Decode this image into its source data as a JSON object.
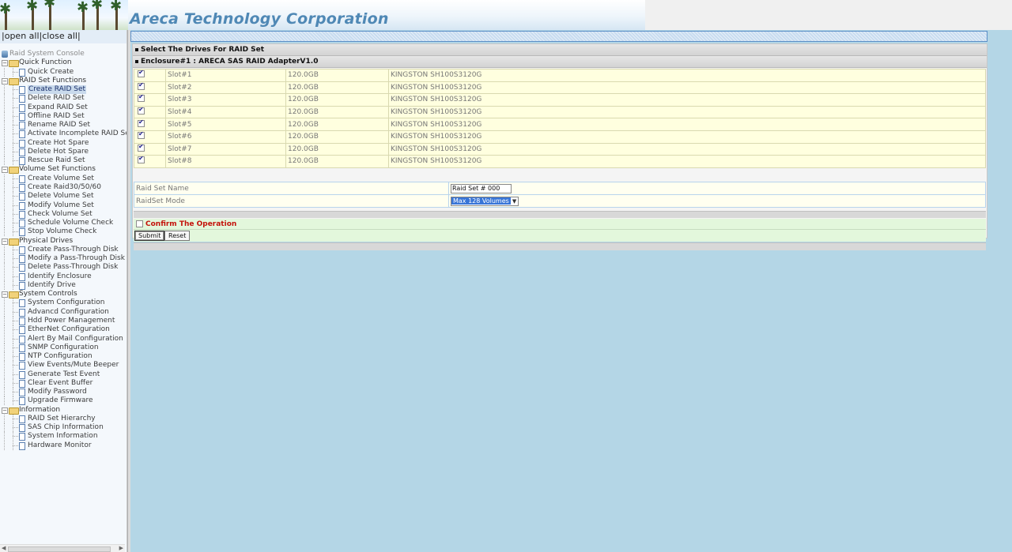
{
  "header": {
    "company": "Areca Technology Corporation"
  },
  "left": {
    "open_all": "open all",
    "close_all": "close all",
    "tree": [
      {
        "type": "root",
        "label": "Raid System Console"
      },
      {
        "type": "cat",
        "label": "Quick Function"
      },
      {
        "type": "leaf",
        "label": "Quick Create"
      },
      {
        "type": "cat",
        "label": "RAID Set Functions"
      },
      {
        "type": "leaf",
        "label": "Create RAID Set",
        "selected": true
      },
      {
        "type": "leaf",
        "label": "Delete RAID Set"
      },
      {
        "type": "leaf",
        "label": "Expand RAID Set"
      },
      {
        "type": "leaf",
        "label": "Offline RAID Set"
      },
      {
        "type": "leaf",
        "label": "Rename RAID Set"
      },
      {
        "type": "leaf",
        "label": "Activate Incomplete RAID Se"
      },
      {
        "type": "leaf",
        "label": "Create Hot Spare"
      },
      {
        "type": "leaf",
        "label": "Delete Hot Spare"
      },
      {
        "type": "leaf",
        "label": "Rescue Raid Set"
      },
      {
        "type": "cat",
        "label": "Volume Set Functions"
      },
      {
        "type": "leaf",
        "label": "Create Volume Set"
      },
      {
        "type": "leaf",
        "label": "Create Raid30/50/60"
      },
      {
        "type": "leaf",
        "label": "Delete Volume Set"
      },
      {
        "type": "leaf",
        "label": "Modify Volume Set"
      },
      {
        "type": "leaf",
        "label": "Check Volume Set"
      },
      {
        "type": "leaf",
        "label": "Schedule Volume Check"
      },
      {
        "type": "leaf",
        "label": "Stop Volume Check"
      },
      {
        "type": "cat",
        "label": "Physical Drives"
      },
      {
        "type": "leaf",
        "label": "Create Pass-Through Disk"
      },
      {
        "type": "leaf",
        "label": "Modify a Pass-Through Disk"
      },
      {
        "type": "leaf",
        "label": "Delete Pass-Through Disk"
      },
      {
        "type": "leaf",
        "label": "Identify Enclosure"
      },
      {
        "type": "leaf",
        "label": "Identify Drive"
      },
      {
        "type": "cat",
        "label": "System Controls"
      },
      {
        "type": "leaf",
        "label": "System Configuration"
      },
      {
        "type": "leaf",
        "label": "Advancd Configuration"
      },
      {
        "type": "leaf",
        "label": "Hdd Power Management"
      },
      {
        "type": "leaf",
        "label": "EtherNet Configuration"
      },
      {
        "type": "leaf",
        "label": "Alert By Mail Configuration"
      },
      {
        "type": "leaf",
        "label": "SNMP Configuration"
      },
      {
        "type": "leaf",
        "label": "NTP Configuration"
      },
      {
        "type": "leaf",
        "label": "View Events/Mute Beeper"
      },
      {
        "type": "leaf",
        "label": "Generate Test Event"
      },
      {
        "type": "leaf",
        "label": "Clear Event Buffer"
      },
      {
        "type": "leaf",
        "label": "Modify Password"
      },
      {
        "type": "leaf",
        "label": "Upgrade Firmware"
      },
      {
        "type": "cat",
        "label": "Information"
      },
      {
        "type": "leaf",
        "label": "RAID Set Hierarchy"
      },
      {
        "type": "leaf",
        "label": "SAS Chip Information"
      },
      {
        "type": "leaf",
        "label": "System Information"
      },
      {
        "type": "leaf",
        "label": "Hardware Monitor"
      }
    ]
  },
  "main": {
    "section_title": "Select The Drives For RAID Set",
    "enclosure_title": "Enclosure#1 : ARECA SAS RAID AdapterV1.0",
    "drives": [
      {
        "checked": true,
        "slot": "Slot#1",
        "size": "120.0GB",
        "model": "KINGSTON SH100S3120G"
      },
      {
        "checked": true,
        "slot": "Slot#2",
        "size": "120.0GB",
        "model": "KINGSTON SH100S3120G"
      },
      {
        "checked": true,
        "slot": "Slot#3",
        "size": "120.0GB",
        "model": "KINGSTON SH100S3120G"
      },
      {
        "checked": true,
        "slot": "Slot#4",
        "size": "120.0GB",
        "model": "KINGSTON SH100S3120G"
      },
      {
        "checked": true,
        "slot": "Slot#5",
        "size": "120.0GB",
        "model": "KINGSTON SH100S3120G"
      },
      {
        "checked": true,
        "slot": "Slot#6",
        "size": "120.0GB",
        "model": "KINGSTON SH100S3120G"
      },
      {
        "checked": true,
        "slot": "Slot#7",
        "size": "120.0GB",
        "model": "KINGSTON SH100S3120G"
      },
      {
        "checked": true,
        "slot": "Slot#8",
        "size": "120.0GB",
        "model": "KINGSTON SH100S3120G"
      }
    ],
    "raid_set_name_label": "Raid Set Name",
    "raid_set_name_value": "Raid Set # 000",
    "raid_set_mode_label": "RaidSet Mode",
    "raid_set_mode_value": "Max 128 Volumes",
    "confirm_label": "Confirm The Operation",
    "confirm_checked": false,
    "submit_label": "Submit",
    "reset_label": "Reset"
  }
}
